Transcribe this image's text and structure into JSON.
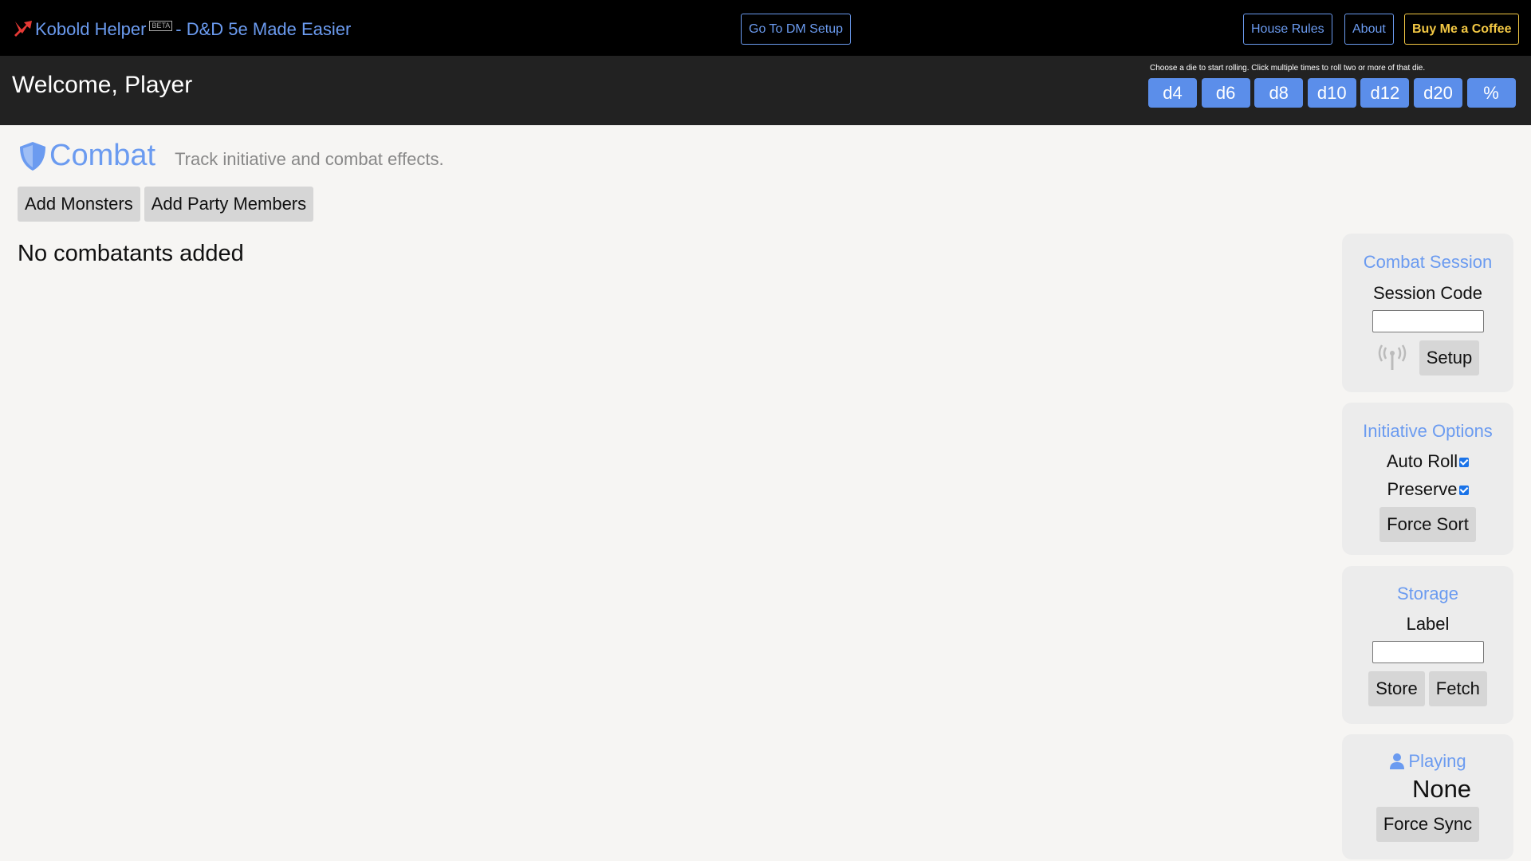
{
  "navbar": {
    "brand_name": "Kobold Helper",
    "beta_badge": "BETA",
    "tagline": "- D&D 5e Made Easier",
    "dm_setup_label": "Go To DM Setup",
    "house_rules_label": "House Rules",
    "about_label": "About",
    "coffee_label": "Buy Me a Coffee"
  },
  "welcome": {
    "text": "Welcome, Player",
    "dice_hint": "Choose a die to start rolling. Click multiple times to roll two or more of that die.",
    "dice": [
      "d4",
      "d6",
      "d8",
      "d10",
      "d12",
      "d20",
      "%"
    ]
  },
  "combat": {
    "title": "Combat",
    "subtitle": "Track initiative and combat effects.",
    "add_monsters_label": "Add Monsters",
    "add_party_label": "Add Party Members",
    "empty_message": "No combatants added"
  },
  "session_panel": {
    "title": "Combat Session",
    "session_code_label": "Session Code",
    "session_code_value": "",
    "setup_label": "Setup"
  },
  "initiative_panel": {
    "title": "Initiative Options",
    "auto_roll_label": "Auto Roll",
    "auto_roll_checked": true,
    "preserve_label": "Preserve",
    "preserve_checked": true,
    "force_sort_label": "Force Sort"
  },
  "storage_panel": {
    "title": "Storage",
    "label_label": "Label",
    "label_value": "",
    "store_label": "Store",
    "fetch_label": "Fetch"
  },
  "playing_panel": {
    "title": "Playing",
    "value": "None",
    "force_sync_label": "Force Sync"
  },
  "colors": {
    "accent_blue": "#6b9bf0",
    "die_button": "#5b8eea",
    "coffee_yellow": "#f3c844",
    "navbar_bg": "#000000",
    "welcome_bg": "#222222"
  }
}
